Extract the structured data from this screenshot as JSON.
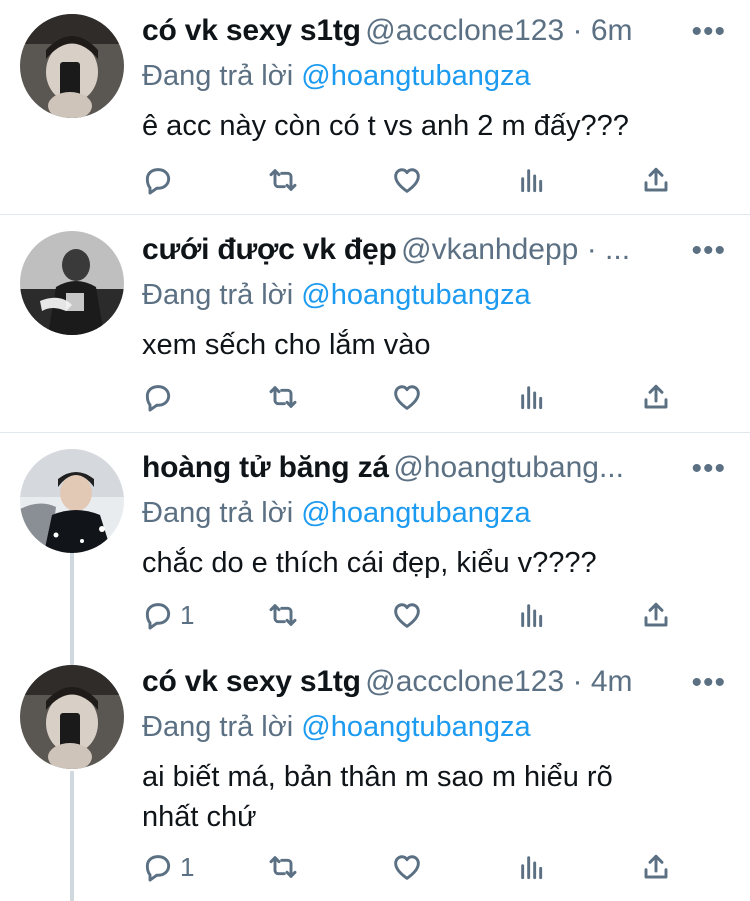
{
  "tweets": [
    {
      "name": "có vk sexy s1tg",
      "handle": "@accclone123",
      "separator": " · ",
      "time": "6m",
      "reply_prefix": "Đang trả lời ",
      "reply_to": "@hoangtubangza",
      "text": "ê acc này còn có t vs anh 2 m đấy???",
      "reply_count": "",
      "more": "•••"
    },
    {
      "name": "cưới được vk đẹp",
      "handle": "@vkanhdepp",
      "separator": " · ",
      "time": "...",
      "reply_prefix": "Đang trả lời ",
      "reply_to": "@hoangtubangza",
      "text": "xem sếch cho lắm vào",
      "reply_count": "",
      "more": "•••"
    },
    {
      "name": "hoàng tử băng zá",
      "handle": "@hoangtubang...",
      "separator": "",
      "time": "",
      "reply_prefix": "Đang trả lời ",
      "reply_to": "@hoangtubangza",
      "text": "chắc do e thích cái đẹp, kiểu v????",
      "reply_count": "1",
      "more": "•••"
    },
    {
      "name": "có vk sexy s1tg",
      "handle": "@accclone123",
      "separator": " · ",
      "time": "4m",
      "reply_prefix": "Đang trả lời ",
      "reply_to": "@hoangtubangza",
      "text": "ai biết má, bản thân m sao m hiểu rõ nhất chứ",
      "reply_count": "1",
      "more": "•••"
    }
  ],
  "icons": {
    "reply": "reply-icon",
    "retweet": "retweet-icon",
    "like": "like-icon",
    "analytics": "analytics-icon",
    "share": "share-icon",
    "more": "more-icon"
  },
  "colors": {
    "accent": "#1d9bf0",
    "muted": "#5b7083",
    "divider": "#e1e8ed",
    "text": "#0f1419"
  }
}
